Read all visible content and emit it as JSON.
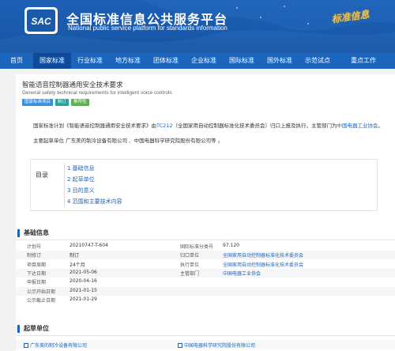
{
  "header": {
    "logo_text": "SAC",
    "site_title": "全国标准信息公共服务平台",
    "site_subtitle": "National public service platform  for standards information",
    "slogan": "标准信息"
  },
  "nav": {
    "items": [
      "首页",
      "国家标准",
      "行业标准",
      "地方标准",
      "团体标准",
      "企业标准",
      "国际标准",
      "国外标准",
      "示范试点",
      "重点工作"
    ],
    "active_index": 1
  },
  "standard": {
    "title": "智能语音控制器通用安全技术要求",
    "title_en": "General safety technical requirements for intelligent voice controls",
    "tags": [
      "国家标准项目",
      "制订",
      "推荐性"
    ],
    "intro_parts": [
      "国家标准计划《智能语音控制器通用安全技术要求》由",
      "TC212",
      "（全国家用自动控制器标准化技术委员会）归口上报及执行，主管部门为",
      "中国电器工业协会",
      "。"
    ],
    "drafters_sentence": "主要起草单位 广东美的制冷设备有限公司 、中国电器科学研究院股份有限公司等 。"
  },
  "toc": {
    "label": "目录",
    "items": [
      "1  基础信息",
      "2  起草单位",
      "3  目的意义",
      "4  范围和主要技术内容"
    ]
  },
  "basic_info": {
    "section_title": "基础信息",
    "rows": [
      {
        "k1": "计划号",
        "v1": "20210747-T-604",
        "k2": "国际标准分类号",
        "v2": "97.120",
        "v2_link": false
      },
      {
        "k1": "制修订",
        "v1": "制订",
        "k2": "归口单位",
        "v2": "全国家用自动控制器标准化技术委员会",
        "v2_link": true
      },
      {
        "k1": "项目周期",
        "v1": "24个月",
        "k2": "执行单位",
        "v2": "全国家用自动控制器标准化技术委员会",
        "v2_link": true
      },
      {
        "k1": "下达日期",
        "v1": "2021-05-06",
        "k2": "主管部门",
        "v2": "中国电器工业协会",
        "v2_link": true
      },
      {
        "k1": "申报日期",
        "v1": "2020-04-16",
        "k2": "",
        "v2": "",
        "v2_link": false
      },
      {
        "k1": "公示开始日期",
        "v1": "2021-01-15",
        "k2": "",
        "v2": "",
        "v2_link": false
      },
      {
        "k1": "公示截止日期",
        "v1": "2021-01-29",
        "k2": "",
        "v2": "",
        "v2_link": false
      }
    ]
  },
  "drafting_units": {
    "section_title": "起草单位",
    "units": [
      "广东美的制冷设备有限公司",
      "中国电器科学研究院股份有限公司"
    ]
  }
}
